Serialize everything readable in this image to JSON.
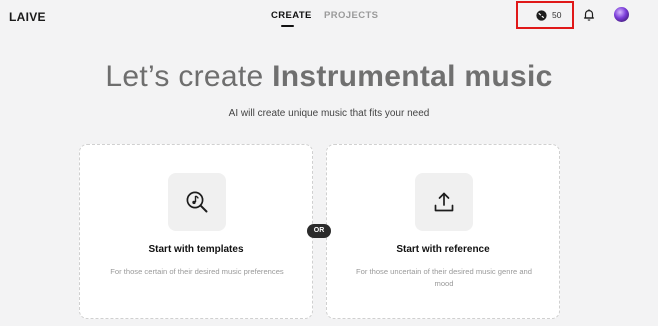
{
  "app": {
    "logo": "LAIVE"
  },
  "nav": {
    "tabs": [
      {
        "label": "CREATE",
        "active": true
      },
      {
        "label": "PROJECTS",
        "active": false
      }
    ]
  },
  "header": {
    "credits": "50",
    "credit_icon": "disc-icon",
    "bell_icon": "bell-icon",
    "avatar": "avatar"
  },
  "hero": {
    "title_prefix": "Let’s create ",
    "title_bold": "Instrumental music",
    "subtitle": "AI will create unique music that fits your need"
  },
  "cards": [
    {
      "title": "Start with templates",
      "description": "For those certain of their desired music preferences",
      "icon": "music-search-icon"
    },
    {
      "title": "Start with reference",
      "description": "For those uncertain of their desired music genre and mood",
      "icon": "upload-icon"
    }
  ],
  "or_label": "OR",
  "colors": {
    "highlight_border": "#e01818",
    "active_underline": "#111111"
  }
}
